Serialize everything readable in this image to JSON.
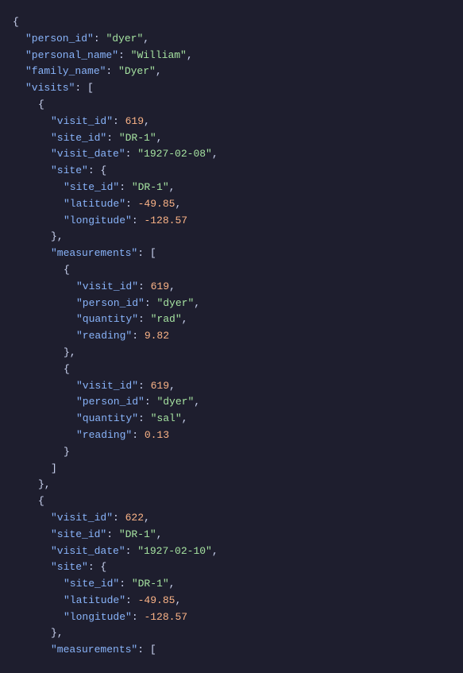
{
  "json": {
    "lines": [
      {
        "indent": 0,
        "content": [
          {
            "type": "brace",
            "text": "{"
          }
        ]
      },
      {
        "indent": 1,
        "content": [
          {
            "type": "key",
            "text": "\"person_id\""
          },
          {
            "type": "colon",
            "text": ": "
          },
          {
            "type": "string-val",
            "text": "\"dyer\""
          },
          {
            "type": "punctuation",
            "text": ","
          }
        ]
      },
      {
        "indent": 1,
        "content": [
          {
            "type": "key",
            "text": "\"personal_name\""
          },
          {
            "type": "colon",
            "text": ": "
          },
          {
            "type": "string-val",
            "text": "\"William\""
          },
          {
            "type": "punctuation",
            "text": ","
          }
        ]
      },
      {
        "indent": 1,
        "content": [
          {
            "type": "key",
            "text": "\"family_name\""
          },
          {
            "type": "colon",
            "text": ": "
          },
          {
            "type": "string-val",
            "text": "\"Dyer\""
          },
          {
            "type": "punctuation",
            "text": ","
          }
        ]
      },
      {
        "indent": 1,
        "content": [
          {
            "type": "key",
            "text": "\"visits\""
          },
          {
            "type": "colon",
            "text": ": "
          },
          {
            "type": "brace",
            "text": "["
          }
        ]
      },
      {
        "indent": 2,
        "content": [
          {
            "type": "brace",
            "text": "{"
          }
        ]
      },
      {
        "indent": 3,
        "content": [
          {
            "type": "key",
            "text": "\"visit_id\""
          },
          {
            "type": "colon",
            "text": ": "
          },
          {
            "type": "number-val",
            "text": "619"
          },
          {
            "type": "punctuation",
            "text": ","
          }
        ]
      },
      {
        "indent": 3,
        "content": [
          {
            "type": "key",
            "text": "\"site_id\""
          },
          {
            "type": "colon",
            "text": ": "
          },
          {
            "type": "string-val",
            "text": "\"DR-1\""
          },
          {
            "type": "punctuation",
            "text": ","
          }
        ]
      },
      {
        "indent": 3,
        "content": [
          {
            "type": "key",
            "text": "\"visit_date\""
          },
          {
            "type": "colon",
            "text": ": "
          },
          {
            "type": "string-val",
            "text": "\"1927-02-08\""
          },
          {
            "type": "punctuation",
            "text": ","
          }
        ]
      },
      {
        "indent": 3,
        "content": [
          {
            "type": "key",
            "text": "\"site\""
          },
          {
            "type": "colon",
            "text": ": "
          },
          {
            "type": "brace",
            "text": "{"
          }
        ]
      },
      {
        "indent": 4,
        "content": [
          {
            "type": "key",
            "text": "\"site_id\""
          },
          {
            "type": "colon",
            "text": ": "
          },
          {
            "type": "string-val",
            "text": "\"DR-1\""
          },
          {
            "type": "punctuation",
            "text": ","
          }
        ]
      },
      {
        "indent": 4,
        "content": [
          {
            "type": "key",
            "text": "\"latitude\""
          },
          {
            "type": "colon",
            "text": ": "
          },
          {
            "type": "number-val",
            "text": "-49.85"
          },
          {
            "type": "punctuation",
            "text": ","
          }
        ]
      },
      {
        "indent": 4,
        "content": [
          {
            "type": "key",
            "text": "\"longitude\""
          },
          {
            "type": "colon",
            "text": ": "
          },
          {
            "type": "number-val",
            "text": "-128.57"
          }
        ]
      },
      {
        "indent": 3,
        "content": [
          {
            "type": "brace",
            "text": "},"
          }
        ]
      },
      {
        "indent": 3,
        "content": [
          {
            "type": "key",
            "text": "\"measurements\""
          },
          {
            "type": "colon",
            "text": ": "
          },
          {
            "type": "brace",
            "text": "["
          }
        ]
      },
      {
        "indent": 4,
        "content": [
          {
            "type": "brace",
            "text": "{"
          }
        ]
      },
      {
        "indent": 5,
        "content": [
          {
            "type": "key",
            "text": "\"visit_id\""
          },
          {
            "type": "colon",
            "text": ": "
          },
          {
            "type": "number-val",
            "text": "619"
          },
          {
            "type": "punctuation",
            "text": ","
          }
        ]
      },
      {
        "indent": 5,
        "content": [
          {
            "type": "key",
            "text": "\"person_id\""
          },
          {
            "type": "colon",
            "text": ": "
          },
          {
            "type": "string-val",
            "text": "\"dyer\""
          },
          {
            "type": "punctuation",
            "text": ","
          }
        ]
      },
      {
        "indent": 5,
        "content": [
          {
            "type": "key",
            "text": "\"quantity\""
          },
          {
            "type": "colon",
            "text": ": "
          },
          {
            "type": "string-val",
            "text": "\"rad\""
          },
          {
            "type": "punctuation",
            "text": ","
          }
        ]
      },
      {
        "indent": 5,
        "content": [
          {
            "type": "key",
            "text": "\"reading\""
          },
          {
            "type": "colon",
            "text": ": "
          },
          {
            "type": "number-val",
            "text": "9.82"
          }
        ]
      },
      {
        "indent": 4,
        "content": [
          {
            "type": "brace",
            "text": "},"
          }
        ]
      },
      {
        "indent": 4,
        "content": [
          {
            "type": "brace",
            "text": "{"
          }
        ]
      },
      {
        "indent": 5,
        "content": [
          {
            "type": "key",
            "text": "\"visit_id\""
          },
          {
            "type": "colon",
            "text": ": "
          },
          {
            "type": "number-val",
            "text": "619"
          },
          {
            "type": "punctuation",
            "text": ","
          }
        ]
      },
      {
        "indent": 5,
        "content": [
          {
            "type": "key",
            "text": "\"person_id\""
          },
          {
            "type": "colon",
            "text": ": "
          },
          {
            "type": "string-val",
            "text": "\"dyer\""
          },
          {
            "type": "punctuation",
            "text": ","
          }
        ]
      },
      {
        "indent": 5,
        "content": [
          {
            "type": "key",
            "text": "\"quantity\""
          },
          {
            "type": "colon",
            "text": ": "
          },
          {
            "type": "string-val",
            "text": "\"sal\""
          },
          {
            "type": "punctuation",
            "text": ","
          }
        ]
      },
      {
        "indent": 5,
        "content": [
          {
            "type": "key",
            "text": "\"reading\""
          },
          {
            "type": "colon",
            "text": ": "
          },
          {
            "type": "number-val",
            "text": "0.13"
          }
        ]
      },
      {
        "indent": 4,
        "content": [
          {
            "type": "brace",
            "text": "}"
          }
        ]
      },
      {
        "indent": 3,
        "content": [
          {
            "type": "brace",
            "text": "]"
          }
        ]
      },
      {
        "indent": 2,
        "content": [
          {
            "type": "brace",
            "text": "},"
          }
        ]
      },
      {
        "indent": 2,
        "content": [
          {
            "type": "brace",
            "text": "{"
          }
        ]
      },
      {
        "indent": 3,
        "content": [
          {
            "type": "key",
            "text": "\"visit_id\""
          },
          {
            "type": "colon",
            "text": ": "
          },
          {
            "type": "number-val",
            "text": "622"
          },
          {
            "type": "punctuation",
            "text": ","
          }
        ]
      },
      {
        "indent": 3,
        "content": [
          {
            "type": "key",
            "text": "\"site_id\""
          },
          {
            "type": "colon",
            "text": ": "
          },
          {
            "type": "string-val",
            "text": "\"DR-1\""
          },
          {
            "type": "punctuation",
            "text": ","
          }
        ]
      },
      {
        "indent": 3,
        "content": [
          {
            "type": "key",
            "text": "\"visit_date\""
          },
          {
            "type": "colon",
            "text": ": "
          },
          {
            "type": "string-val",
            "text": "\"1927-02-10\""
          },
          {
            "type": "punctuation",
            "text": ","
          }
        ]
      },
      {
        "indent": 3,
        "content": [
          {
            "type": "key",
            "text": "\"site\""
          },
          {
            "type": "colon",
            "text": ": "
          },
          {
            "type": "brace",
            "text": "{"
          }
        ]
      },
      {
        "indent": 4,
        "content": [
          {
            "type": "key",
            "text": "\"site_id\""
          },
          {
            "type": "colon",
            "text": ": "
          },
          {
            "type": "string-val",
            "text": "\"DR-1\""
          },
          {
            "type": "punctuation",
            "text": ","
          }
        ]
      },
      {
        "indent": 4,
        "content": [
          {
            "type": "key",
            "text": "\"latitude\""
          },
          {
            "type": "colon",
            "text": ": "
          },
          {
            "type": "number-val",
            "text": "-49.85"
          },
          {
            "type": "punctuation",
            "text": ","
          }
        ]
      },
      {
        "indent": 4,
        "content": [
          {
            "type": "key",
            "text": "\"longitude\""
          },
          {
            "type": "colon",
            "text": ": "
          },
          {
            "type": "number-val",
            "text": "-128.57"
          }
        ]
      },
      {
        "indent": 3,
        "content": [
          {
            "type": "brace",
            "text": "},"
          }
        ]
      },
      {
        "indent": 3,
        "content": [
          {
            "type": "key",
            "text": "\"measurements\""
          },
          {
            "type": "colon",
            "text": ": "
          },
          {
            "type": "brace",
            "text": "["
          }
        ]
      }
    ]
  }
}
